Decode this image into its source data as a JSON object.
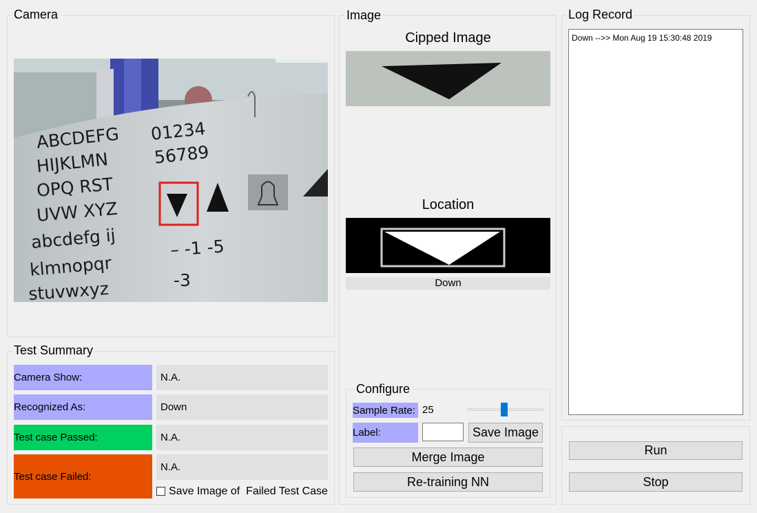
{
  "camera": {
    "title": "Camera"
  },
  "summary": {
    "title": "Test Summary",
    "rows": [
      {
        "label": "Camera Show:",
        "value": "N.A.",
        "color": "#aaaaff"
      },
      {
        "label": "Recognized As:",
        "value": "Down",
        "color": "#aaaaff"
      },
      {
        "label": "Test case Passed:",
        "value": "N.A.",
        "color": "#00d060"
      },
      {
        "label": "Test case Failed:",
        "value": "N.A.",
        "color": "#e65000"
      }
    ],
    "save_failed_label": "Save Image of  Failed Test Case"
  },
  "image": {
    "title": "Image",
    "clipped_title": "Cipped Image",
    "location_title": "Location",
    "location_result": "Down"
  },
  "configure": {
    "title": "Configure",
    "sample_rate_label": "Sample Rate:",
    "sample_rate_value": "25",
    "label_label": "Label:",
    "label_value": "",
    "save_image": "Save Image",
    "merge_image": "Merge Image",
    "retrain": "Re-training NN",
    "slider_fraction": 0.5
  },
  "log": {
    "title": "Log Record",
    "entries": [
      "Down -->> Mon Aug 19 15:30:48 2019"
    ]
  },
  "controls": {
    "run": "Run",
    "stop": "Stop"
  },
  "colors": {
    "purple_tag": "#aaaaff",
    "green_tag": "#00d060",
    "orange_tag": "#e65000",
    "slider_thumb": "#0078d7",
    "detect_box": "#e02020"
  }
}
